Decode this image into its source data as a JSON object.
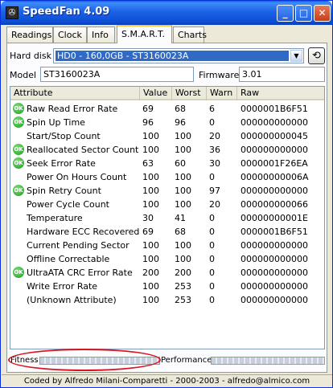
{
  "window": {
    "title": "SpeedFan 4.09",
    "icon": "speedfan-app-icon",
    "controls": {
      "minimize": "_",
      "maximize": "□",
      "close": "✕"
    }
  },
  "tabs": [
    {
      "label": "Readings",
      "active": false
    },
    {
      "label": "Clock",
      "active": false
    },
    {
      "label": "Info",
      "active": false
    },
    {
      "label": "S.M.A.R.T.",
      "active": true
    },
    {
      "label": "Charts",
      "active": false
    }
  ],
  "smart": {
    "hard_disk_label": "Hard disk",
    "hard_disk_selected": "HD0 - 160,0GB - ST3160023A",
    "model_label": "Model",
    "model_value": "ST3160023A",
    "firmware_label": "Firmware",
    "firmware_value": "3.01",
    "columns": [
      "Attribute",
      "Value",
      "Worst",
      "Warn",
      "Raw"
    ],
    "rows": [
      {
        "ok": true,
        "attribute": "Raw Read Error Rate",
        "value": "69",
        "worst": "68",
        "warn": "6",
        "raw": "0000001B6F51"
      },
      {
        "ok": true,
        "attribute": "Spin Up Time",
        "value": "96",
        "worst": "96",
        "warn": "0",
        "raw": "000000000000"
      },
      {
        "ok": false,
        "attribute": "Start/Stop Count",
        "value": "100",
        "worst": "100",
        "warn": "20",
        "raw": "000000000045"
      },
      {
        "ok": true,
        "attribute": "Reallocated Sector Count",
        "value": "100",
        "worst": "100",
        "warn": "36",
        "raw": "000000000000"
      },
      {
        "ok": true,
        "attribute": "Seek Error Rate",
        "value": "63",
        "worst": "60",
        "warn": "30",
        "raw": "0000001F26EA"
      },
      {
        "ok": false,
        "attribute": "Power On Hours Count",
        "value": "100",
        "worst": "100",
        "warn": "0",
        "raw": "00000000006A"
      },
      {
        "ok": true,
        "attribute": "Spin Retry Count",
        "value": "100",
        "worst": "100",
        "warn": "97",
        "raw": "000000000000"
      },
      {
        "ok": false,
        "attribute": "Power Cycle Count",
        "value": "100",
        "worst": "100",
        "warn": "20",
        "raw": "000000000066"
      },
      {
        "ok": false,
        "attribute": "Temperature",
        "value": "30",
        "worst": "41",
        "warn": "0",
        "raw": "00000000001E"
      },
      {
        "ok": false,
        "attribute": "Hardware ECC Recovered",
        "value": "69",
        "worst": "68",
        "warn": "0",
        "raw": "0000001B6F51"
      },
      {
        "ok": false,
        "attribute": "Current Pending Sector",
        "value": "100",
        "worst": "100",
        "warn": "0",
        "raw": "000000000000"
      },
      {
        "ok": false,
        "attribute": "Offline Correctable",
        "value": "100",
        "worst": "100",
        "warn": "0",
        "raw": "000000000000"
      },
      {
        "ok": true,
        "attribute": "UltraATA CRC Error Rate",
        "value": "200",
        "worst": "200",
        "warn": "0",
        "raw": "000000000000"
      },
      {
        "ok": false,
        "attribute": "Write Error Rate",
        "value": "100",
        "worst": "253",
        "warn": "0",
        "raw": "000000000000"
      },
      {
        "ok": false,
        "attribute": "(Unknown Attribute)",
        "value": "100",
        "worst": "253",
        "warn": "0",
        "raw": "000000000000"
      }
    ],
    "ok_badge": "OK",
    "fitness_label": "Fitness",
    "performance_label": "Performance"
  },
  "statusbar": {
    "text": "Coded by Alfredo Milani-Comparetti - 2000-2003 - alfredo@almico.com"
  },
  "colors": {
    "titlebar": "#0a5fe8",
    "selection": "#316ac5",
    "ok_icon": "#1a9b1a",
    "annotation_oval": "#d9141b"
  }
}
